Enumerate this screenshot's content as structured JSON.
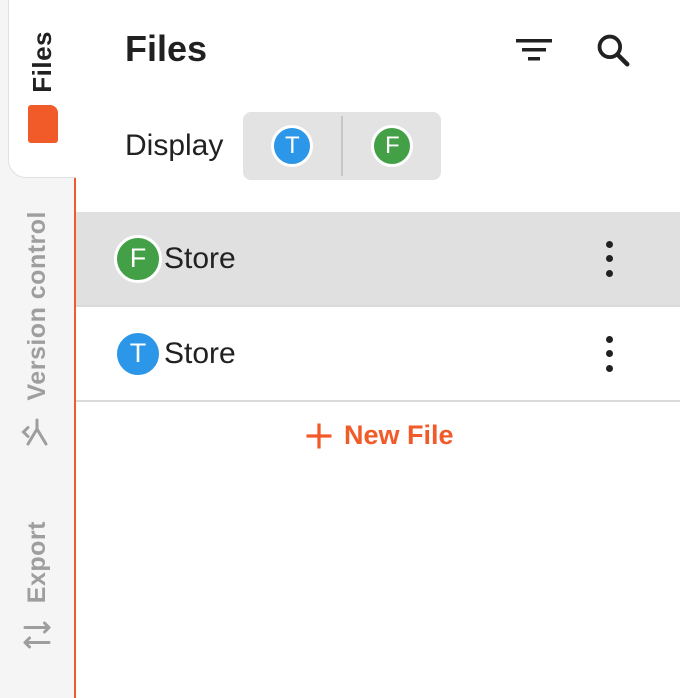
{
  "rail": {
    "tabs": [
      {
        "label": "Files",
        "icon": "folder-icon",
        "active": true
      },
      {
        "label": "Version control",
        "icon": "merge-icon",
        "active": false
      },
      {
        "label": "Export",
        "icon": "swap-arrows-icon",
        "active": false
      }
    ]
  },
  "header": {
    "title": "Files"
  },
  "display": {
    "label": "Display",
    "options": [
      {
        "letter": "T",
        "color": "#2c97e8"
      },
      {
        "letter": "F",
        "color": "#43a047"
      }
    ]
  },
  "files": [
    {
      "badge": "F",
      "name": "Store",
      "selected": true
    },
    {
      "badge": "T",
      "name": "Store",
      "selected": false
    }
  ],
  "actions": {
    "new_file": "New File"
  },
  "colors": {
    "accent": "#f15a29",
    "badge_t": "#2c97e8",
    "badge_f": "#43a047",
    "selected_row": "#e0e0e0"
  }
}
